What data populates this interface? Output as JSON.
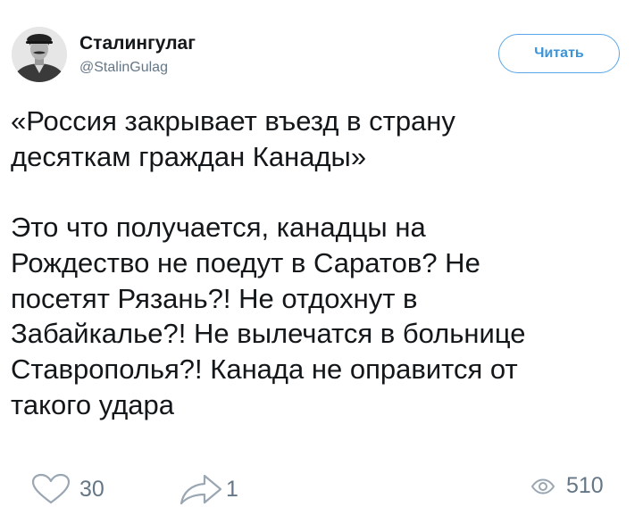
{
  "user": {
    "display_name": "Сталингулаг",
    "handle": "@StalinGulag",
    "avatar_icon": "portrait-avatar"
  },
  "follow_button": {
    "label": "Читать"
  },
  "tweet": {
    "text": "«Россия закрывает въезд в страну\nдесяткам граждан Канады»\n\nЭто что получается, канадцы на\nРождество не поедут в Саратов? Не\nпосетят Рязань?! Не отдохнут в\nЗабайкалье?! Не вылечатся в больнице\nСтаврополья?! Канада не оправится от\nтакого удара"
  },
  "actions": {
    "likes": {
      "icon": "heart-icon",
      "count": "30"
    },
    "shares": {
      "icon": "share-icon",
      "count": "1"
    },
    "views": {
      "icon": "eye-icon",
      "count": "510"
    }
  },
  "colors": {
    "accent": "#3b94d9",
    "text": "#14171a",
    "muted": "#657786"
  }
}
